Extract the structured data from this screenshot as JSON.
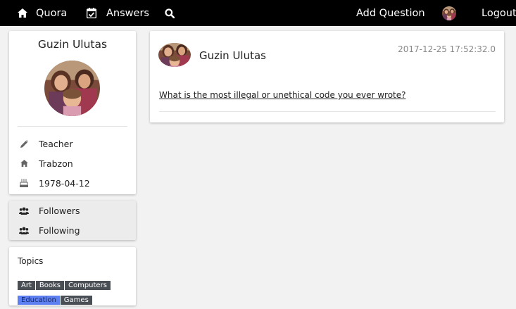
{
  "nav": {
    "brand_label": "Quora",
    "answers_label": "Answers",
    "add_question_label": "Add Question",
    "logout_label": "Logout"
  },
  "profile": {
    "name": "Guzin Ulutas",
    "occupation": "Teacher",
    "location": "Trabzon",
    "birthdate": "1978-04-12"
  },
  "follow": {
    "followers_label": "Followers",
    "following_label": "Following"
  },
  "topics": {
    "title": "Topics",
    "tags": [
      {
        "label": "Art"
      },
      {
        "label": "Books"
      },
      {
        "label": "Computers"
      },
      {
        "label": "Education",
        "active": true
      },
      {
        "label": "Games"
      }
    ]
  },
  "question": {
    "author": "Guzin Ulutas",
    "timestamp": "2017-12-25 17:52:32.0",
    "text": "What is the most illegal or unethical code you ever wrote?"
  },
  "colors": {
    "topbar": "#000000",
    "background": "#f2f2f2",
    "active_tag": "#5d7ff0",
    "tag": "#4a4f56"
  },
  "icons": {
    "brand": "home-icon",
    "answers": "calendar-check-icon",
    "search": "search-icon",
    "occupation": "pencil-icon",
    "location": "home-icon",
    "birthdate": "birthday-cake-icon",
    "followers": "users-icon",
    "following": "users-icon"
  }
}
